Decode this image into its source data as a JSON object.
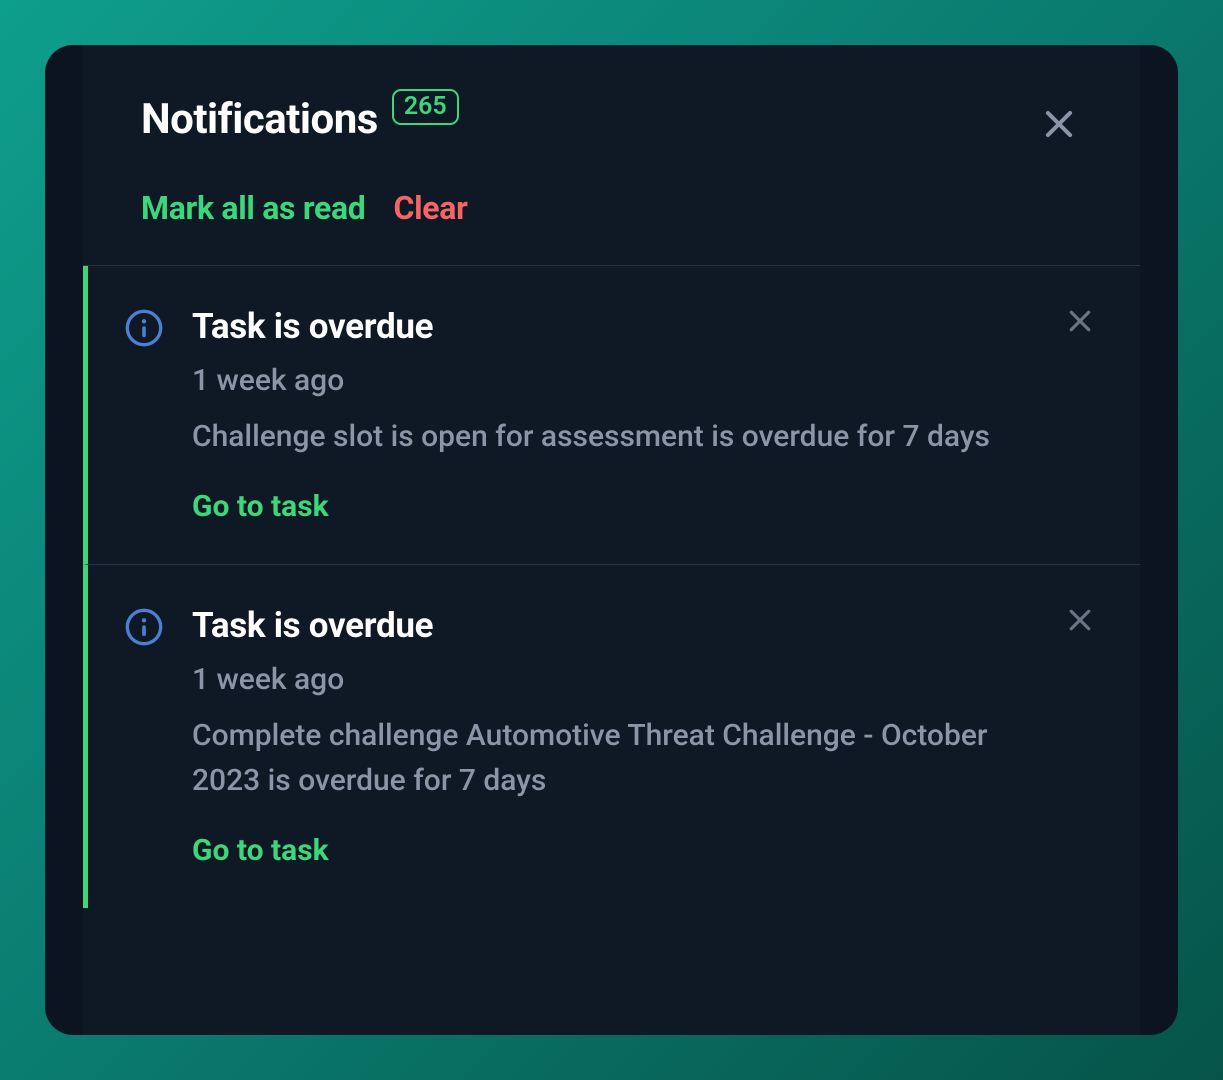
{
  "header": {
    "title": "Notifications",
    "badge_count": "265",
    "mark_all_label": "Mark all as read",
    "clear_label": "Clear"
  },
  "notifications": [
    {
      "title": "Task is overdue",
      "time": "1 week ago",
      "description": "Challenge slot is open for assessment is overdue for 7 days",
      "action_label": "Go to task"
    },
    {
      "title": "Task is overdue",
      "time": "1 week ago",
      "description": "Complete challenge Automotive Threat Challenge - October 2023 is overdue for 7 days",
      "action_label": "Go to task"
    }
  ]
}
